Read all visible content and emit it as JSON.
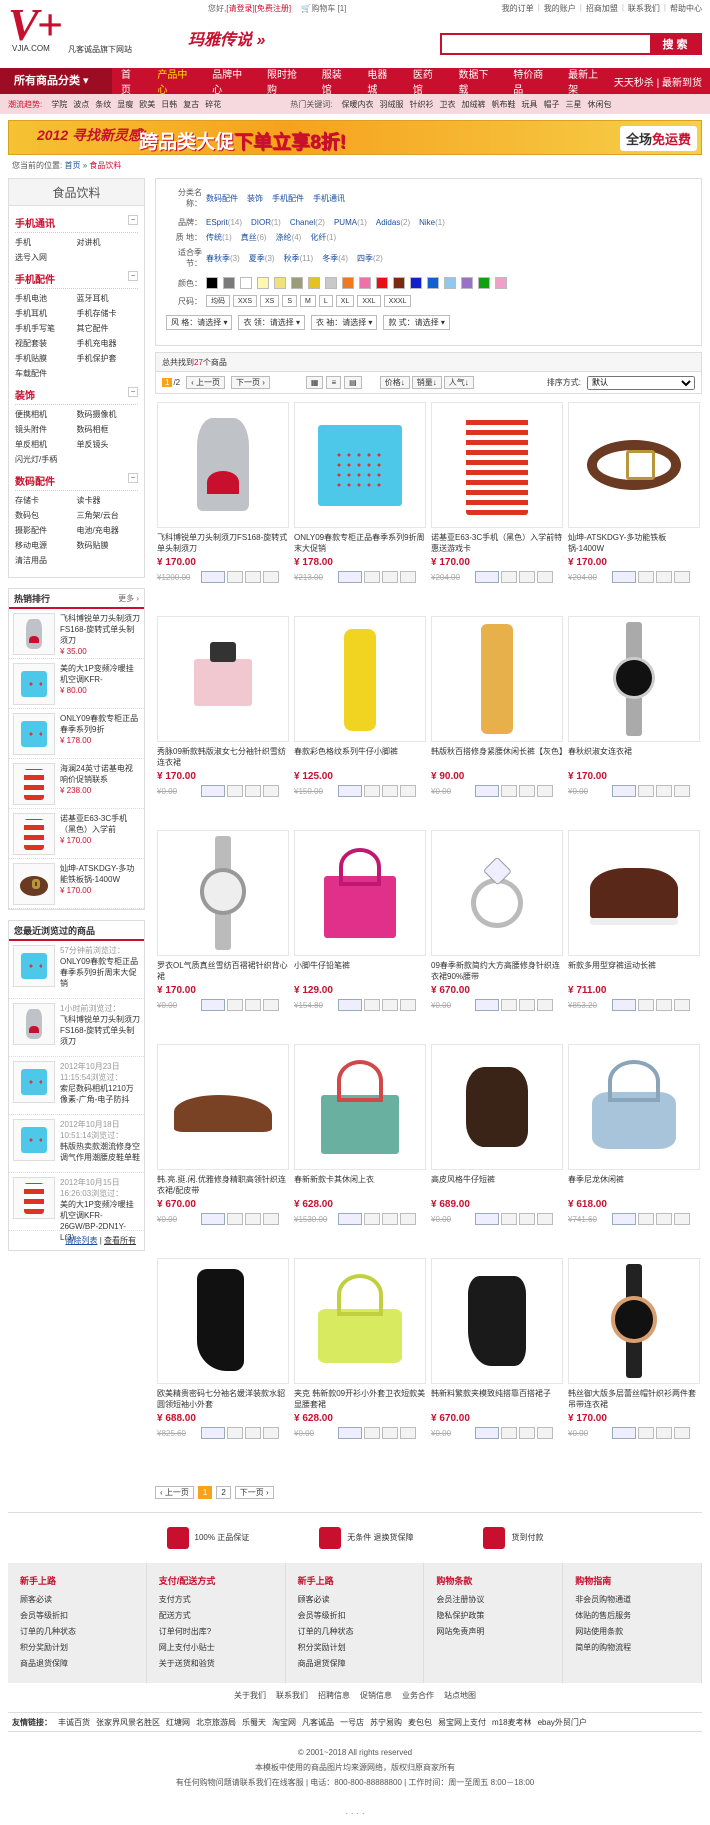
{
  "header": {
    "logo": "V+",
    "domain": "VJIA.COM",
    "slogan": "凡客诚品旗下网站",
    "greeting_prefix": "您好,",
    "login": "[请登录]",
    "register": "[免费注册]",
    "cart": "购物车",
    "cart_count": "[1]",
    "links": [
      "我的订单",
      "我的账户",
      "招商加盟",
      "联系我们",
      "帮助中心"
    ],
    "brand": "玛雅传说 »",
    "search_btn": "搜 索",
    "search_placeholder": ""
  },
  "nav": {
    "all": "所有商品分类",
    "items": [
      "首页",
      "产品中心",
      "品牌中心",
      "限时抢购",
      "服装馆",
      "电器城",
      "医药馆",
      "数据下载",
      "特价商品",
      "最新上架"
    ],
    "active": "产品中心",
    "right": "天天秒杀 | 最新到货"
  },
  "subnav": {
    "label": "潮流趋势:",
    "tags": [
      "学院",
      "波点",
      "条纹",
      "显瘦",
      "欧美",
      "日韩",
      "复古",
      "碎花"
    ],
    "hot_label": "热门关键词:",
    "hot": [
      "保暖内衣",
      "羽绒服",
      "针织衫",
      "卫衣",
      "加绒裤",
      "帆布鞋",
      "玩具",
      "帽子",
      "三星",
      "休闲包"
    ]
  },
  "banner": {
    "t1": "2012 寻找新灵感!",
    "t2a": "跨品类大促",
    "t2b": "下单立享8折!",
    "t3a": "全场",
    "t3b": "免运费"
  },
  "crumb": {
    "label": "您当前的位置:",
    "home": "首页",
    "sep": "»",
    "current": "食品饮料"
  },
  "left": {
    "title": "食品饮料",
    "cats": [
      {
        "title": "手机通讯",
        "items": [
          "手机",
          "对讲机",
          "选号入网"
        ]
      },
      {
        "title": "手机配件",
        "items": [
          "手机电池",
          "蓝牙耳机",
          "手机耳机",
          "手机存储卡",
          "手机手写笔",
          "其它配件",
          "视配套装",
          "手机充电器",
          "手机贴膜",
          "手机保护套",
          "车载配件"
        ]
      },
      {
        "title": "装饰",
        "items": [
          "便携相机",
          "数码摄像机",
          "镜头附件",
          "数码相框",
          "单反相机",
          "单反镜头",
          "闪光灯/手柄"
        ]
      },
      {
        "title": "数码配件",
        "items": [
          "存储卡",
          "读卡器",
          "数码包",
          "三角架/云台",
          "摄影配件",
          "电池/充电器",
          "移动电源",
          "数码贴膜",
          "清洁用品"
        ]
      }
    ],
    "hot_title": "热销排行",
    "hot_more": "更多 ›",
    "hot": [
      {
        "name": "飞科博锐单刀头制须刀FS168-旋转式单头制须刀",
        "price": "¥ 35.00"
      },
      {
        "name": "美的大1P变频冷暖挂机空调KFR-",
        "price": "¥ 80.00"
      },
      {
        "name": "ONLY09春款专柜正品春季系列9折",
        "price": "¥ 178.00"
      },
      {
        "name": "海澜24英寸诺基电视响价促销联系",
        "price": "¥ 238.00"
      },
      {
        "name": "诺基亚E63-3C手机（黑色）入学前",
        "price": "¥ 170.00"
      },
      {
        "name": "灿坤-ATSKDGY-多功能铁板锅-1400W",
        "price": "¥ 170.00"
      }
    ],
    "recent_title": "您最近浏览过的商品",
    "recent": [
      {
        "when": "57分钟前浏览过：",
        "name": "ONLY09春款专柜正品春季系列9折周末大促销"
      },
      {
        "when": "1小时前浏览过：",
        "name": "飞科博锐单刀头制须刀FS168-旋转式单头制须刀"
      },
      {
        "when": "2012年10月23日 11:15:54浏览过：",
        "name": "索尼数码相机1210万像素-广角-电子防抖"
      },
      {
        "when": "2012年10月18日 10:51:14浏览过：",
        "name": "韩版热卖款潮流修身空调气作用潮腰皮鞋单鞋"
      },
      {
        "when": "2012年10月15日 16:26:03浏览过：",
        "name": "美的大1P变频冷暖挂机空调KFR-26GW/BP-2DN1Y-L(3)"
      }
    ],
    "clear": "清除列表",
    "viewall": "查看所有"
  },
  "filter": {
    "cat_label": "分类名称：",
    "cats": [
      "数码配件",
      "装饰",
      "手机配件",
      "手机通讯"
    ],
    "brand_label": "品牌：",
    "brands": [
      [
        "ESprit",
        "(14)"
      ],
      [
        "DIOR",
        "(1)"
      ],
      [
        "Chanel",
        "(2)"
      ],
      [
        "PUMA",
        "(1)"
      ],
      [
        "Adidas",
        "(2)"
      ],
      [
        "Nike",
        "(1)"
      ]
    ],
    "place_label": "质 地：",
    "places": [
      [
        "传统",
        "(1)"
      ],
      [
        "真丝",
        "(6)"
      ],
      [
        "涤纶",
        "(4)"
      ],
      [
        "化纤",
        "(1)"
      ]
    ],
    "season_label": "适合季节：",
    "seasons": [
      [
        "春秋季",
        "(3)"
      ],
      [
        "夏季",
        "(3)"
      ],
      [
        "秋季",
        "(11)"
      ],
      [
        "冬季",
        "(4)"
      ],
      [
        "四季",
        "(2)"
      ]
    ],
    "color_label": "颜色：",
    "colors": [
      "#000000",
      "#7a7a7a",
      "#ffffff",
      "#fff6b0",
      "#f2e07a",
      "#9c9c78",
      "#e5c220",
      "#c9c9c9",
      "#f07a20",
      "#f070a8",
      "#e81010",
      "#7a2a10",
      "#1020d0",
      "#1060d0",
      "#90c8f0",
      "#9a70c8",
      "#10a010",
      "#f0a0c8"
    ],
    "size_label": "尺码：",
    "sizes": [
      "均码",
      "XXS",
      "XS",
      "S",
      "M",
      "L",
      "XL",
      "XXL",
      "XXXL"
    ],
    "selects": [
      "风 格：请选择",
      "衣 领：请选择",
      "衣 袖：请选择",
      "款 式：请选择"
    ]
  },
  "listing": {
    "count_a": "总共找到",
    "count_n": "27",
    "count_b": "个商品",
    "page": "1",
    "pages": "/2",
    "prev": "上一页",
    "next": "下一页",
    "sort": [
      "价格",
      "销量",
      "人气"
    ],
    "sort_label": "排序方式:",
    "sort_value": "默认"
  },
  "products": [
    {
      "name": "飞科博锐单刀头制须刀FS168-旋转式单头制须刀",
      "price": "¥ 170.00",
      "old": "¥1200.00",
      "art": "hoodie"
    },
    {
      "name": "ONLY09春款专柜正品春季系列9折周末大促销",
      "price": "¥ 178.00",
      "old": "¥213.00",
      "art": "tee"
    },
    {
      "name": "诺基亚E63-3C手机（黑色）入学前特惠送游戏卡",
      "price": "¥ 170.00",
      "old": "¥204.00",
      "art": "stripe"
    },
    {
      "name": "灿坤-ATSKDGY-多功能铁板锅-1400W",
      "price": "¥ 170.00",
      "old": "¥204.00",
      "art": "belt"
    },
    {
      "name": "秀脉09新款韩版淑女七分袖针织雪纺连衣裙",
      "price": "¥ 170.00",
      "old": "¥0.00",
      "art": "perfume"
    },
    {
      "name": "春款彩色格纹系列牛仔小脚裤",
      "price": "¥ 125.00",
      "old": "¥150.00",
      "art": "bottle"
    },
    {
      "name": "韩版秋百搭修身紧腰休闲长裤【灰色】",
      "price": "¥ 90.00",
      "old": "¥0.00",
      "art": "shampoo"
    },
    {
      "name": "春秋织淑女连衣裙",
      "price": "¥ 170.00",
      "old": "¥0.00",
      "art": "watch"
    },
    {
      "name": "罗衣OL气质真丝雪纺百褶裙针织背心裙",
      "price": "¥ 170.00",
      "old": "¥0.00",
      "art": "watch2"
    },
    {
      "name": "小脚牛仔铅笔裤",
      "price": "¥ 129.00",
      "old": "¥154.80",
      "art": "pinkbag"
    },
    {
      "name": "09春季新款简约大方高腰修身针织连衣裙90%腰带",
      "price": "¥ 670.00",
      "old": "¥0.00",
      "art": "ring"
    },
    {
      "name": "新款多用型穿裤运动长裤",
      "price": "¥ 711.00",
      "old": "¥853.20",
      "art": "boot"
    },
    {
      "name": "韩.亮.挺.闲.优雅修身精职高领针织连衣裙/配皮带",
      "price": "¥ 670.00",
      "old": "¥0.00",
      "art": "shoe"
    },
    {
      "name": "春新新款卡其休闲上衣",
      "price": "¥ 628.00",
      "old": "¥1530.00",
      "art": "greenbag"
    },
    {
      "name": "高皮风格牛仔短裤",
      "price": "¥ 689.00",
      "old": "¥0.00",
      "art": "ankle"
    },
    {
      "name": "春季尼龙休闲裤",
      "price": "¥ 618.00",
      "old": "¥741.60",
      "art": "bluebag"
    },
    {
      "name": "欧美精贵密码七分袖名媛洋装款水貂圆领短袖小外套",
      "price": "¥ 688.00",
      "old": "¥825.60",
      "art": "tallboot"
    },
    {
      "name": "夹克 韩新款09开衫小外套卫衣短款美显腰套裙",
      "price": "¥ 628.00",
      "old": "¥0.00",
      "art": "limebag"
    },
    {
      "name": "韩新料繁款夹模致纯搭靠百搭裙子",
      "price": "¥ 670.00",
      "old": "¥0.00",
      "art": "bootie"
    },
    {
      "name": "韩丝御大版多层蕾丝帽针织衫两件套吊带连衣裙",
      "price": "¥ 170.00",
      "old": "¥0.00",
      "art": "watch3"
    }
  ],
  "pager": {
    "prev": "‹ 上一页",
    "pages": [
      "1",
      "2"
    ],
    "next": "下一页 ›"
  },
  "assure": [
    {
      "t": "100% 正品保证",
      "c": "#c8102e"
    },
    {
      "t": "无条件 退换货保障",
      "c": "#c8102e"
    },
    {
      "t": "货到付款",
      "c": "#c8102e"
    }
  ],
  "help": [
    {
      "h": "新手上路",
      "items": [
        "顾客必读",
        "会员等级折扣",
        "订单的几种状态",
        "积分奖励计划",
        "商品退货保障"
      ]
    },
    {
      "h": "支付/配送方式",
      "items": [
        "支付方式",
        "配送方式",
        "订单何时出库?",
        "网上支付小贴士",
        "关于送货和验货"
      ]
    },
    {
      "h": "新手上路",
      "items": [
        "顾客必读",
        "会员等级折扣",
        "订单的几种状态",
        "积分奖励计划",
        "商品退货保障"
      ]
    },
    {
      "h": "购物条款",
      "items": [
        "会员注册协议",
        "隐私保护政策",
        "网站免责声明"
      ]
    },
    {
      "h": "购物指南",
      "items": [
        "非会员购物通道",
        "体贴的售后服务",
        "网站使用条款",
        "简单的购物流程"
      ]
    }
  ],
  "flinks": [
    "关于我们",
    "联系我们",
    "招聘信息",
    "促销信息",
    "业务合作",
    "站点地图"
  ],
  "friends": {
    "label": "友情链接：",
    "items": [
      "丰诚百货",
      "张家界风景名胜区",
      "红塘网",
      "北京旅游局",
      "乐蜀天",
      "淘宝网",
      "凡客诚品",
      "一号店",
      "苏宁易购",
      "麦包包",
      "易宝网上支付",
      "m18麦考林",
      "ebay外贸门户"
    ]
  },
  "copy": [
    "© 2001~2018 All rights reserved",
    "本模板中使用的商品图片均来源网络，版权归原商家所有",
    "有任何购物问题请联系我们在线客服 | 电话：800-800-88888800 | 工作时间：周一至周五 8:00－18:00"
  ]
}
